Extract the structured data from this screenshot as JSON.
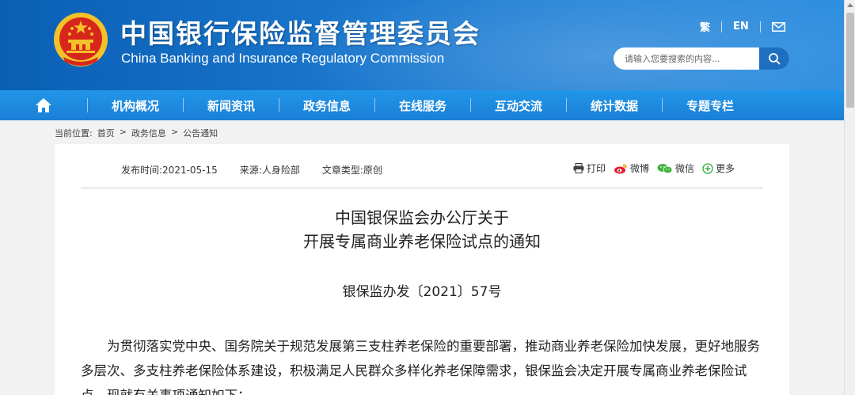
{
  "header": {
    "title_cn": "中国银行保险监督管理委员会",
    "title_en": "China Banking and Insurance Regulatory Commission",
    "lang_traditional": "繁",
    "lang_en": "EN",
    "search_placeholder": "请输入您要搜索的内容..."
  },
  "nav": {
    "items": [
      "机构概况",
      "新闻资讯",
      "政务信息",
      "在线服务",
      "互动交流",
      "统计数据",
      "专题专栏"
    ]
  },
  "breadcrumb": {
    "label": "当前位置:",
    "home": "首页",
    "sep": ">",
    "section": "政务信息",
    "page": "公告通知"
  },
  "meta": {
    "date": "发布时间:2021-05-15",
    "source": "来源:人身险部",
    "type": "文章类型:原创"
  },
  "share": {
    "print": "打印",
    "weibo": "微博",
    "wechat": "微信",
    "more": "更多"
  },
  "article": {
    "title_line1": "中国银保监会办公厅关于",
    "title_line2": "开展专属商业养老保险试点的通知",
    "doc_number": "银保监办发〔2021〕57号",
    "paragraph": "为贯彻落实党中央、国务院关于规范发展第三支柱养老保险的重要部署，推动商业养老保险加快发展，更好地服务多层次、多支柱养老保险体系建设，积极满足人民群众多样化养老保障需求，银保监会决定开展专属商业养老保险试点。现就有关事项通知如下："
  },
  "colors": {
    "header_blue": "#1b78cf",
    "nav_blue": "#1a7fd6",
    "emblem_red": "#d7261b",
    "emblem_gold": "#f3c12a"
  }
}
